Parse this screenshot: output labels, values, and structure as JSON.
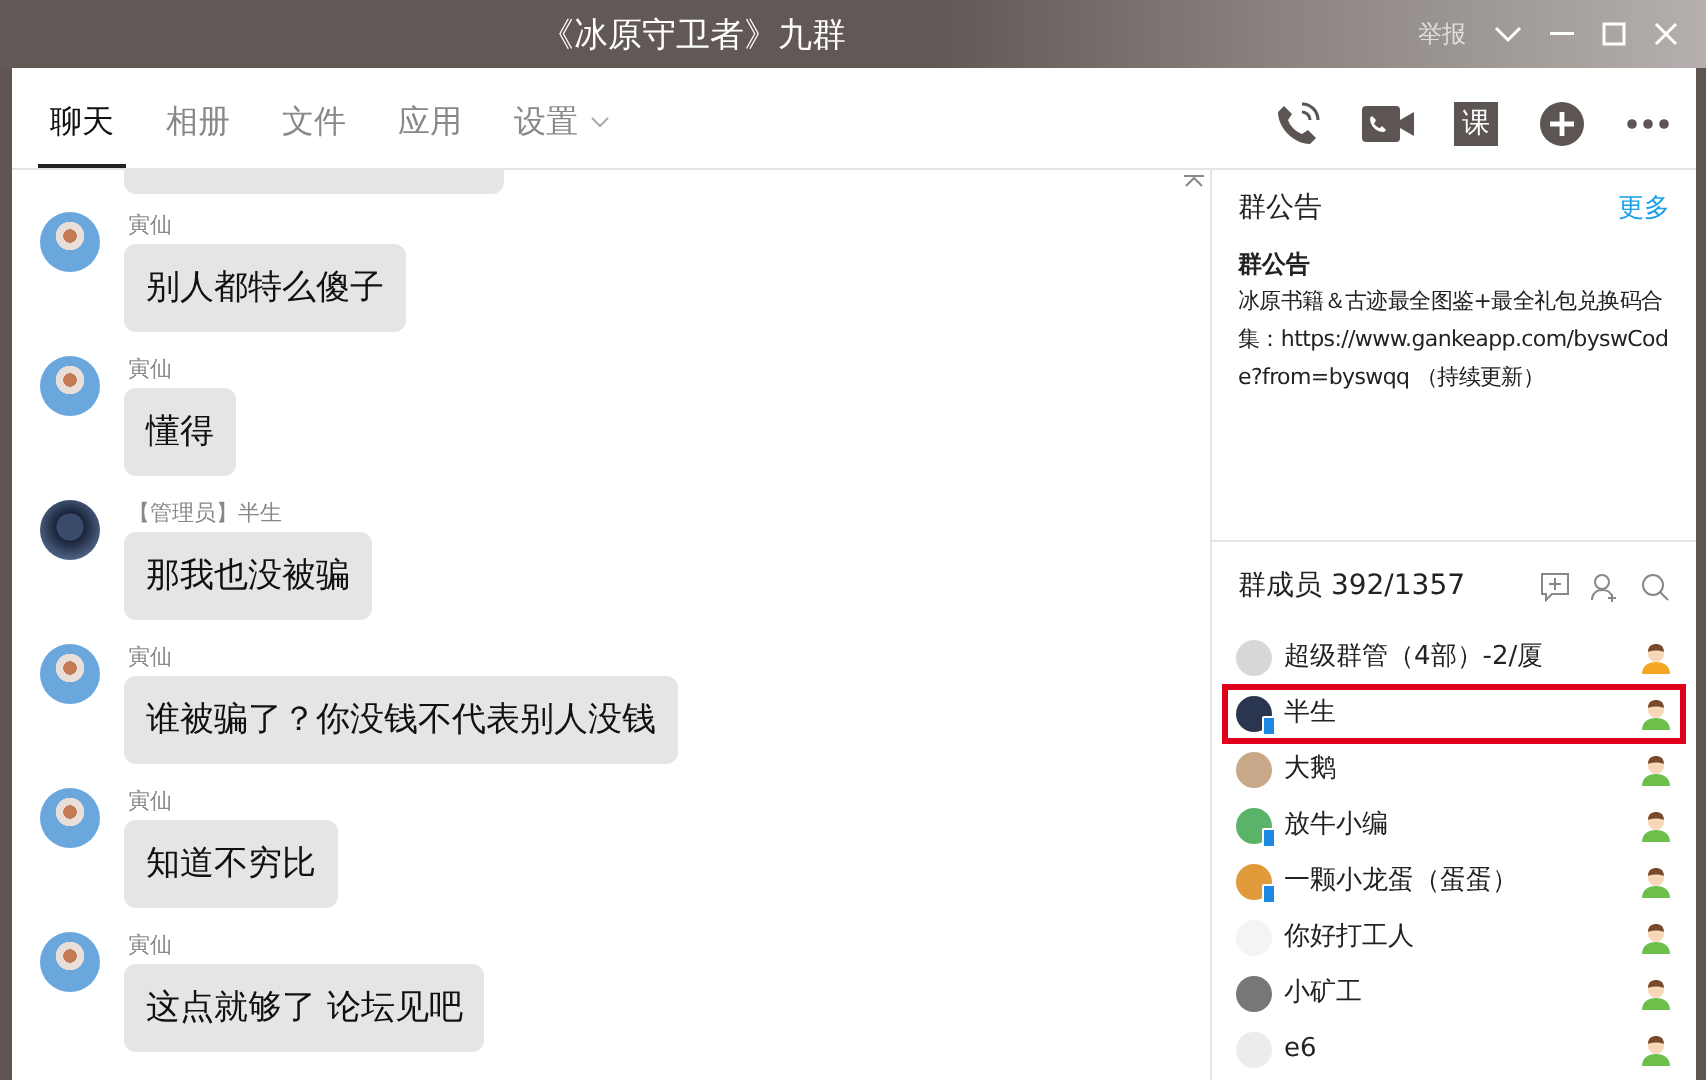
{
  "window": {
    "title": "《冰原守卫者》九群",
    "report": "举报"
  },
  "tabs": [
    {
      "label": "聊天",
      "selected": true
    },
    {
      "label": "相册",
      "selected": false
    },
    {
      "label": "文件",
      "selected": false
    },
    {
      "label": "应用",
      "selected": false
    },
    {
      "label": "设置",
      "selected": false,
      "dropdown": true
    }
  ],
  "toolbar": [
    {
      "kind": "phone"
    },
    {
      "kind": "video"
    },
    {
      "kind": "course",
      "label": "课"
    },
    {
      "kind": "add"
    },
    {
      "kind": "more"
    }
  ],
  "messages": [
    {
      "sender": "寅仙",
      "kind": "sky",
      "text": "别人都特么傻子"
    },
    {
      "sender": "寅仙",
      "kind": "sky",
      "text": "懂得"
    },
    {
      "sender": "【管理员】半生",
      "kind": "dark",
      "text": "那我也没被骗"
    },
    {
      "sender": "寅仙",
      "kind": "sky",
      "text": "谁被骗了？你没钱不代表别人没钱"
    },
    {
      "sender": "寅仙",
      "kind": "sky",
      "text": "知道不穷比"
    },
    {
      "sender": "寅仙",
      "kind": "sky",
      "text": "这点就够了 论坛见吧"
    }
  ],
  "announcement": {
    "heading": "群公告",
    "more": "更多",
    "title": "群公告",
    "body": "冰原书籍＆古迹最全图鉴+最全礼包兑换码合集：https://www.gankeapp.com/byswCode?from=byswqq （持续更新）"
  },
  "members": {
    "heading": "群成员 392/1357",
    "items": [
      {
        "name": "超级群管（4部）-2/厦",
        "color": "#f5a623",
        "mobile": false,
        "selected": false
      },
      {
        "name": "半生",
        "color": "#6cc04a",
        "mobile": true,
        "selected": true
      },
      {
        "name": "大鹅",
        "color": "#6cc04a",
        "mobile": false,
        "selected": false
      },
      {
        "name": "放牛小编",
        "color": "#6cc04a",
        "mobile": true,
        "selected": false
      },
      {
        "name": "一颗小龙蛋（蛋蛋）",
        "color": "#6cc04a",
        "mobile": true,
        "selected": false
      },
      {
        "name": "你好打工人",
        "color": "#6cc04a",
        "mobile": false,
        "selected": false
      },
      {
        "name": "小矿工",
        "color": "#6cc04a",
        "mobile": false,
        "selected": false
      },
      {
        "name": "e6",
        "color": "#6cc04a",
        "mobile": false,
        "selected": false
      }
    ]
  }
}
